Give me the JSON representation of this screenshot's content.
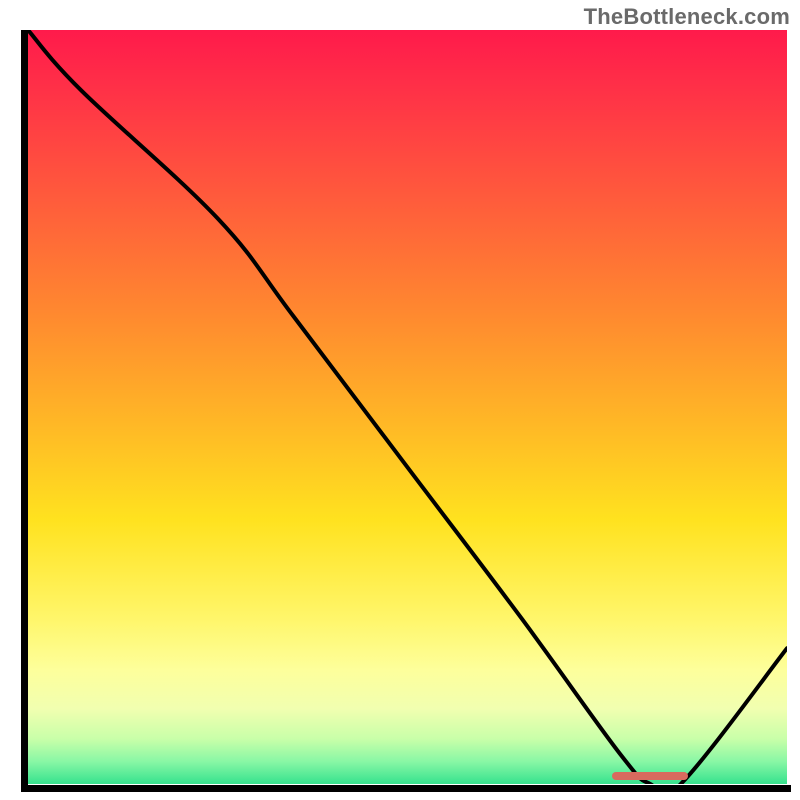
{
  "watermark": "TheBottleneck.com",
  "colors": {
    "gradient_top": "#ff1a4b",
    "gradient_bottom": "#36e28e",
    "marker": "#d86a5e",
    "axis": "#000000",
    "curve": "#000000"
  },
  "chart_data": {
    "type": "line",
    "title": "",
    "xlabel": "",
    "ylabel": "",
    "xlim": [
      0,
      100
    ],
    "ylim": [
      0,
      100
    ],
    "grid": false,
    "legend": false,
    "series": [
      {
        "name": "bottleneck-curve",
        "x": [
          0,
          7,
          25,
          35,
          50,
          65,
          78,
          82,
          86,
          100
        ],
        "y": [
          100,
          92,
          75,
          62,
          42,
          22,
          4,
          0,
          0,
          18
        ]
      }
    ],
    "annotations": [
      {
        "name": "optimal-range-marker",
        "type": "segment",
        "x_start": 77,
        "x_end": 87,
        "y": 0
      }
    ]
  }
}
